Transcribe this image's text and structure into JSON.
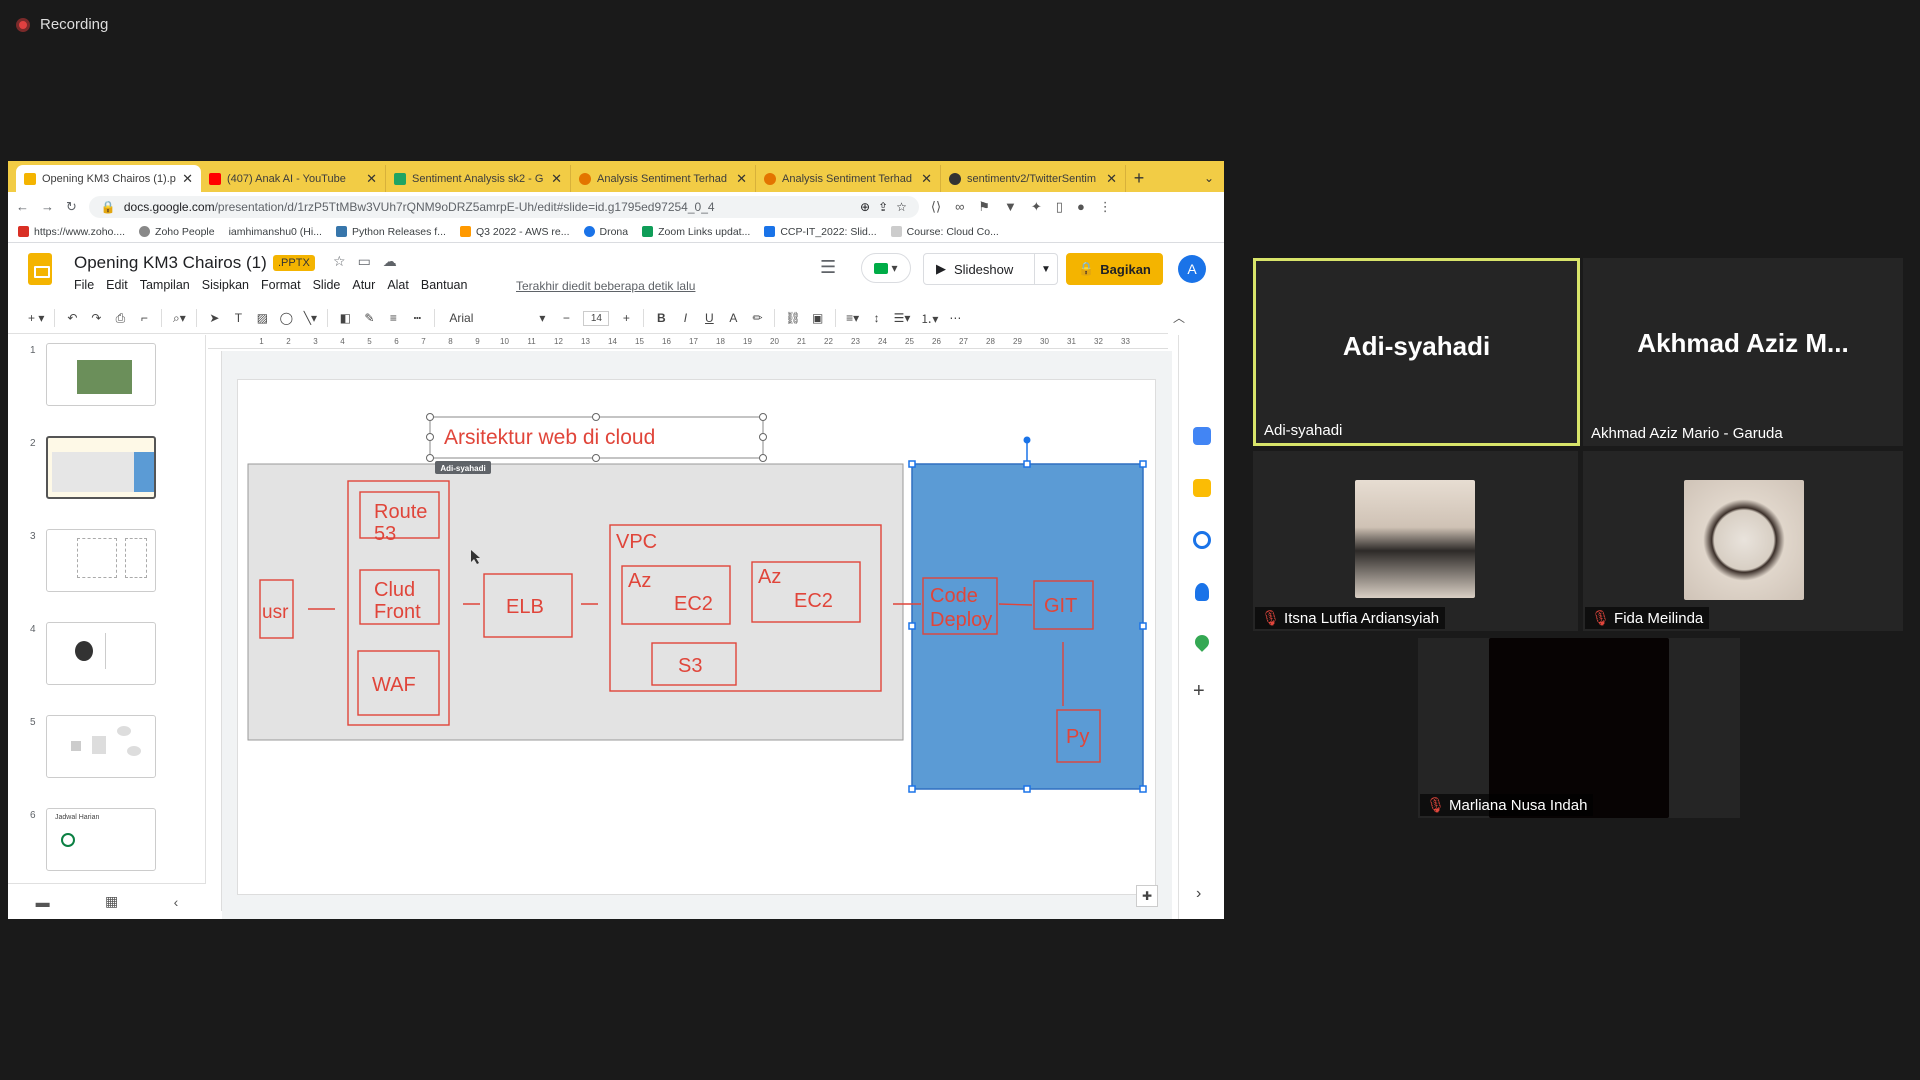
{
  "recording": {
    "label": "Recording"
  },
  "browser": {
    "tabs": [
      {
        "title": "Opening KM3 Chairos (1).p",
        "color": "#f4b400",
        "active": true
      },
      {
        "title": "(407) Anak AI - YouTube",
        "color": "#ff0000"
      },
      {
        "title": "Sentiment Analysis sk2 - G",
        "color": "#1fa463"
      },
      {
        "title": "Analysis Sentiment Terhad",
        "color": "#e37400"
      },
      {
        "title": "Analysis Sentiment Terhad",
        "color": "#e37400"
      },
      {
        "title": "sentimentv2/TwitterSentim",
        "color": "#333333"
      }
    ],
    "url_domain": "docs.google.com",
    "url_path": "/presentation/d/1rzP5TtMBw3VUh7rQNM9oDRZ5amrpE-Uh/edit#slide=id.g1795ed97254_0_4",
    "bookmarks": [
      "https://www.zoho....",
      "Zoho People",
      "iamhimanshu0 (Hi...",
      "Python Releases f...",
      "Q3 2022 - AWS re...",
      "Drona",
      "Zoom Links updat...",
      "CCP-IT_2022: Slid...",
      "Course: Cloud Co..."
    ]
  },
  "slides_app": {
    "doc_title": "Opening KM3 Chairos (1)",
    "badge": ".PPTX",
    "menu": [
      "File",
      "Edit",
      "Tampilan",
      "Sisipkan",
      "Format",
      "Slide",
      "Atur",
      "Alat",
      "Bantuan"
    ],
    "last_edit": "Terakhir diedit beberapa detik lalu",
    "slideshow_label": "Slideshow",
    "share_label": "Bagikan",
    "account_initial": "A",
    "font_name": "Arial",
    "font_size": "14",
    "thumbs": [
      "1",
      "2",
      "3",
      "4",
      "5",
      "6"
    ],
    "thumb6_title": "Jadwal Harian"
  },
  "diagram": {
    "title": "Arsitektur web di cloud",
    "cursor_label": "Adi-syahadi",
    "usr": "usr",
    "route_1": "Route",
    "route_2": "53",
    "cf_1": "Clud",
    "cf_2": "Front",
    "waf": "WAF",
    "elb": "ELB",
    "vpc": "VPC",
    "az1_a": "Az",
    "az1_b": "EC2",
    "az2_a": "Az",
    "az2_b": "EC2",
    "s3": "S3",
    "cd_1": "Code",
    "cd_2": "Deploy",
    "git": "GIT",
    "py": "Py"
  },
  "participants": [
    {
      "big": "Adi-syahadi",
      "name": "Adi-syahadi"
    },
    {
      "big": "Akhmad Aziz M...",
      "name": "Akhmad Aziz Mario - Garuda"
    },
    {
      "name": "Itsna Lutfia Ardiansyiah"
    },
    {
      "name": "Fida Meilinda"
    },
    {
      "name": "Marliana Nusa Indah"
    }
  ],
  "colors": {
    "speaker_border": "#d8e46a",
    "slides_yellow": "#f4b400",
    "diagram_red": "#e0453a",
    "selection_blue": "#5b9bd5"
  }
}
